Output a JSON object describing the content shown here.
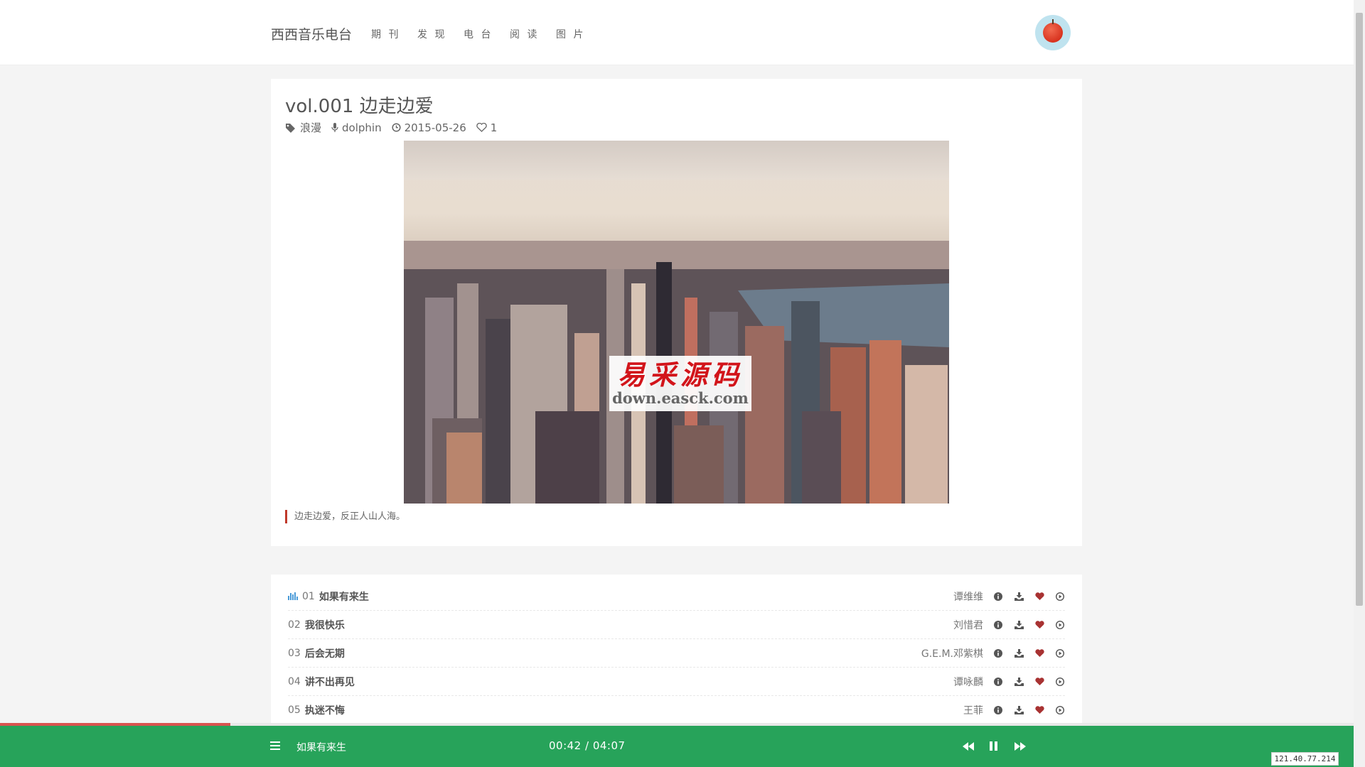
{
  "header": {
    "brand": "西西音乐电台",
    "nav": [
      "期 刊",
      "发 现",
      "电 台",
      "阅 读",
      "图 片"
    ],
    "avatar_icon": "apple-avatar-icon"
  },
  "article": {
    "title": "vol.001 边走边爱",
    "tag": "浪漫",
    "author": "dolphin",
    "date": "2015-05-26",
    "likes": "1",
    "watermark_cn": "易采源码",
    "watermark_en": "down.easck.com",
    "quote": "边走边爱，反正人山人海。"
  },
  "tracks": [
    {
      "num": "01",
      "name": "如果有来生",
      "artist": "谭维维",
      "playing": true
    },
    {
      "num": "02",
      "name": "我很快乐",
      "artist": "刘惜君",
      "playing": false
    },
    {
      "num": "03",
      "name": "后会无期",
      "artist": "G.E.M.邓紫棋",
      "playing": false
    },
    {
      "num": "04",
      "name": "讲不出再见",
      "artist": "谭咏麟",
      "playing": false
    },
    {
      "num": "05",
      "name": "执迷不悔",
      "artist": "王菲",
      "playing": false
    }
  ],
  "player": {
    "now_playing": "如果有来生",
    "time": "00:42 / 04:07",
    "progress": 0.17
  },
  "ip": "121.40.77.214",
  "colors": {
    "player_bg": "#27a35a",
    "accent_red": "#c0392b",
    "heart": "#a83232"
  }
}
